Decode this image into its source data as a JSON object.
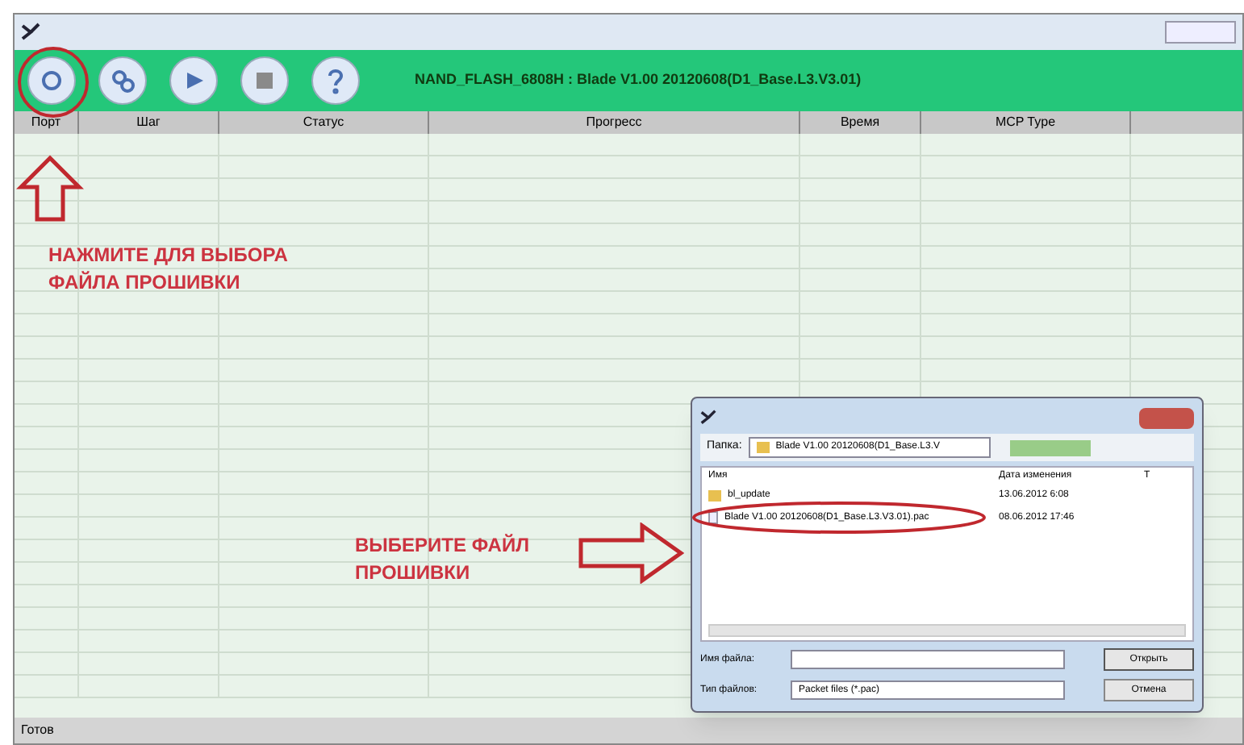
{
  "toolbar": {
    "buttons": [
      {
        "kind": "search"
      },
      {
        "kind": "settings"
      },
      {
        "kind": "play"
      },
      {
        "kind": "stop"
      },
      {
        "kind": "help"
      }
    ],
    "title": "NAND_FLASH_6808H : Blade V1.00 20120608(D1_Base.L3.V3.01)"
  },
  "table": {
    "columns": [
      "Порт",
      "Шаг",
      "Статус",
      "Прогресс",
      "Время",
      "MCP Type"
    ]
  },
  "status_bar": {
    "text": "Готов"
  },
  "dialog": {
    "folder_label": "Папка:",
    "folder_value": "Blade V1.00 20120608(D1_Base.L3.V",
    "columns": [
      "Имя",
      "Дата изменения",
      "Т"
    ],
    "files": [
      {
        "kind": "folder",
        "name": "bl_update",
        "date": "13.06.2012 6:08"
      },
      {
        "kind": "file",
        "name": "Blade V1.00 20120608(D1_Base.L3.V3.01).pac",
        "date": "08.06.2012 17:46"
      }
    ],
    "filename_label": "Имя файла:",
    "filetype_label": "Тип файлов:",
    "filetype_value": "Packet files (*.pac)",
    "buttons": [
      "Открыть",
      "Отмена"
    ]
  },
  "annotations": [
    {
      "text": "НАЖМИТЕ ДЛЯ ВЫБОРА ФАЙЛА ПРОШИВКИ"
    },
    {
      "text": "ВЫБЕРИТЕ ФАЙЛ ПРОШИВКИ"
    }
  ]
}
